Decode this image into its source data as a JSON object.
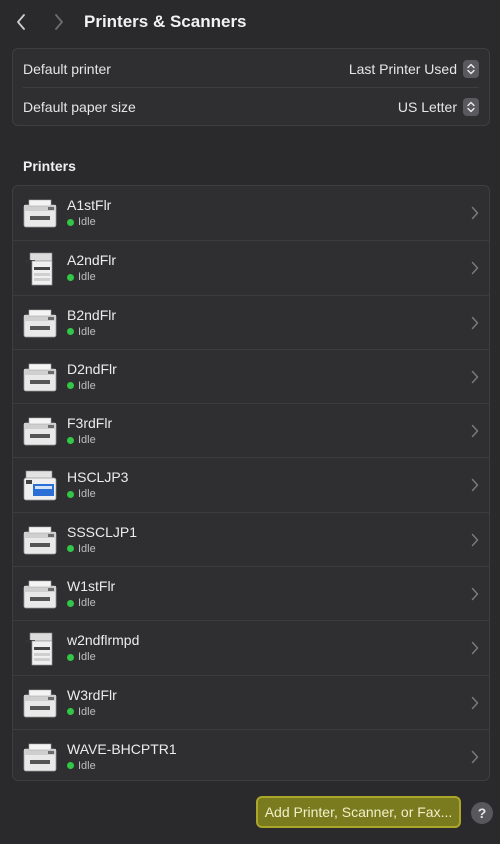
{
  "window": {
    "title": "Printers & Scanners"
  },
  "settings": {
    "default_printer": {
      "label": "Default printer",
      "value": "Last Printer Used"
    },
    "default_paper": {
      "label": "Default paper size",
      "value": "US Letter"
    }
  },
  "printers_section": {
    "title": "Printers"
  },
  "printers": [
    {
      "name": "A1stFlr",
      "status": "Idle",
      "icon": "laser-printer-icon"
    },
    {
      "name": "A2ndFlr",
      "status": "Idle",
      "icon": "copier-printer-icon"
    },
    {
      "name": "B2ndFlr",
      "status": "Idle",
      "icon": "laser-printer-icon"
    },
    {
      "name": "D2ndFlr",
      "status": "Idle",
      "icon": "laser-printer-icon"
    },
    {
      "name": "F3rdFlr",
      "status": "Idle",
      "icon": "laser-printer-icon"
    },
    {
      "name": "HSCLJP3",
      "status": "Idle",
      "icon": "color-mfp-printer-icon"
    },
    {
      "name": "SSSCLJP1",
      "status": "Idle",
      "icon": "laser-printer-icon"
    },
    {
      "name": "W1stFlr",
      "status": "Idle",
      "icon": "laser-printer-icon"
    },
    {
      "name": "w2ndflrmpd",
      "status": "Idle",
      "icon": "copier-printer-icon"
    },
    {
      "name": "W3rdFlr",
      "status": "Idle",
      "icon": "laser-printer-icon"
    },
    {
      "name": "WAVE-BHCPTR1",
      "status": "Idle",
      "icon": "laser-printer-icon"
    }
  ],
  "actions": {
    "add_label": "Add Printer, Scanner, or Fax...",
    "help_label": "?"
  },
  "colors": {
    "status_idle": "#33c748",
    "highlight": "#a9a62a"
  }
}
